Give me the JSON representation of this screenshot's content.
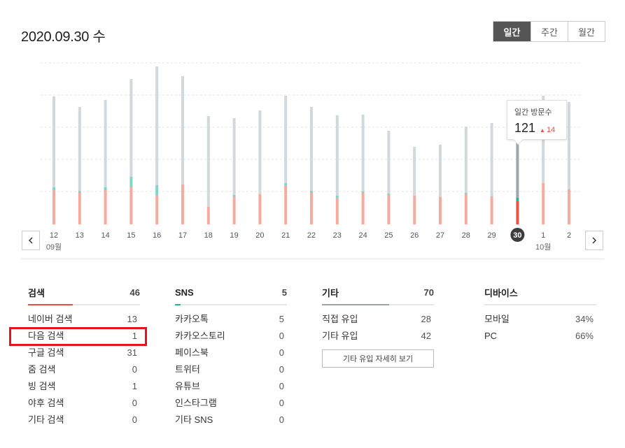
{
  "header": {
    "date": "2020.09.30 수"
  },
  "period_tabs": [
    {
      "label": "일간",
      "active": true
    },
    {
      "label": "주간",
      "active": false
    },
    {
      "label": "월간",
      "active": false
    }
  ],
  "chart_data": {
    "type": "bar",
    "categories": [
      "12",
      "13",
      "14",
      "15",
      "16",
      "17",
      "18",
      "19",
      "20",
      "21",
      "22",
      "23",
      "24",
      "25",
      "26",
      "27",
      "28",
      "29",
      "30",
      "1",
      "2"
    ],
    "month_labels": {
      "12": "09월",
      "1": "10월"
    },
    "selected": "30",
    "series": [
      {
        "values": [
          130,
          120,
          125,
          140,
          170,
          155,
          130,
          110,
          120,
          125,
          120,
          115,
          110,
          90,
          70,
          75,
          95,
          105,
          140,
          125,
          125
        ]
      },
      {
        "values": [
          3,
          3,
          4,
          15,
          14,
          0,
          0,
          3,
          0,
          3,
          3,
          3,
          2,
          2,
          0,
          0,
          2,
          0,
          5,
          0,
          0
        ]
      },
      {
        "values": [
          50,
          45,
          49,
          53,
          42,
          57,
          25,
          39,
          43,
          56,
          45,
          38,
          45,
          42,
          41,
          39,
          43,
          40,
          33,
          59,
          50
        ]
      }
    ],
    "colors": {
      "top": "#d3d8db",
      "middle": "#7fd6c9",
      "bottom": "#f6aba0",
      "selected_top": "#9ea7ae",
      "selected_middle": "#1fb6a6",
      "selected_bottom": "#f0503f"
    },
    "grid": true,
    "legend": "none"
  },
  "tooltip": {
    "label": "일간 방문수",
    "value": "121",
    "delta_arrow": "▲",
    "delta": "14"
  },
  "sections": [
    {
      "title": "검색",
      "total": "46",
      "fill_fraction": 0.4,
      "fill_color": "#f04a3a",
      "rows": [
        {
          "label": "네이버 검색",
          "value": "13"
        },
        {
          "label": "다음 검색",
          "value": "1"
        },
        {
          "label": "구글 검색",
          "value": "31"
        },
        {
          "label": "줌 검색",
          "value": "0"
        },
        {
          "label": "빙 검색",
          "value": "1"
        },
        {
          "label": "야후 검색",
          "value": "0"
        },
        {
          "label": "기타 검색",
          "value": "0"
        }
      ]
    },
    {
      "title": "SNS",
      "total": "5",
      "fill_fraction": 0.05,
      "fill_color": "#1fb6a6",
      "rows": [
        {
          "label": "카카오톡",
          "value": "5"
        },
        {
          "label": "카카오스토리",
          "value": "0"
        },
        {
          "label": "페이스북",
          "value": "0"
        },
        {
          "label": "트위터",
          "value": "0"
        },
        {
          "label": "유튜브",
          "value": "0"
        },
        {
          "label": "인스타그램",
          "value": "0"
        },
        {
          "label": "기타 SNS",
          "value": "0"
        }
      ]
    },
    {
      "title": "기타",
      "total": "70",
      "fill_fraction": 0.6,
      "fill_color": "#9aa3aa",
      "rows": [
        {
          "label": "직접 유입",
          "value": "28"
        },
        {
          "label": "기타 유입",
          "value": "42"
        }
      ],
      "button_label": "기타 유입 자세히 보기"
    },
    {
      "title": "디바이스",
      "total": "",
      "fill_fraction": 0,
      "fill_color": "#9aa3aa",
      "rows": [
        {
          "label": "모바일",
          "value": "34%"
        },
        {
          "label": "PC",
          "value": "66%"
        }
      ]
    }
  ],
  "icons": {
    "prev": "chevron-left-icon",
    "next": "chevron-right-icon"
  }
}
